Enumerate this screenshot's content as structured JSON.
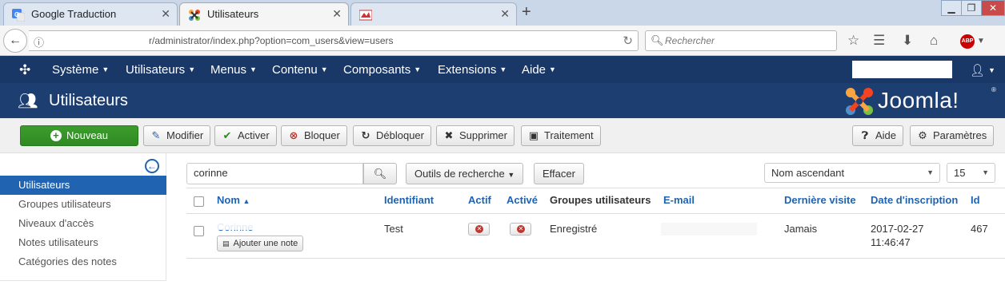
{
  "browser": {
    "tabs": [
      {
        "title": "Google Traduction",
        "icon": "google-translate-icon"
      },
      {
        "title": "Utilisateurs",
        "icon": "joomla-icon",
        "active": true
      },
      {
        "title": "",
        "icon": "site-favicon"
      }
    ],
    "url": "r/administrator/index.php?option=com_users&view=users",
    "search_placeholder": "Rechercher",
    "abp_label": "ABP"
  },
  "menu": {
    "items": [
      "Système",
      "Utilisateurs",
      "Menus",
      "Contenu",
      "Composants",
      "Extensions",
      "Aide"
    ]
  },
  "header": {
    "title": "Utilisateurs",
    "logo_text": "Joomla!",
    "logo_reg": "®"
  },
  "toolbar": {
    "new": "Nouveau",
    "edit": "Modifier",
    "activate": "Activer",
    "block": "Bloquer",
    "unblock": "Débloquer",
    "delete": "Supprimer",
    "batch": "Traitement",
    "help": "Aide",
    "options": "Paramètres"
  },
  "sidebar": {
    "items": [
      {
        "label": "Utilisateurs",
        "active": true
      },
      {
        "label": "Groupes utilisateurs"
      },
      {
        "label": "Niveaux d'accès"
      },
      {
        "label": "Notes utilisateurs"
      },
      {
        "label": "Catégories des notes"
      }
    ]
  },
  "filters": {
    "search_value": "corinne",
    "search_tools": "Outils de recherche",
    "clear": "Effacer",
    "ordering": "Nom ascendant",
    "limit": "15"
  },
  "table": {
    "columns": [
      "Nom",
      "Identifiant",
      "Actif",
      "Activé",
      "Groupes utilisateurs",
      "E-mail",
      "Dernière visite",
      "Date d'inscription",
      "Id"
    ],
    "rows": [
      {
        "name": "Corinne",
        "add_note": "Ajouter une note",
        "username": "Test",
        "groups": "Enregistré",
        "last_visit": "Jamais",
        "registered_date": "2017-02-27",
        "registered_time": "11:46:47",
        "id": "467"
      }
    ]
  },
  "colors": {
    "menu_bar": "#1a3867",
    "title_bar": "#1d3e71",
    "accent_blue": "#1f63b1",
    "green_button": "#2f8a23",
    "danger_red": "#bd362f"
  }
}
